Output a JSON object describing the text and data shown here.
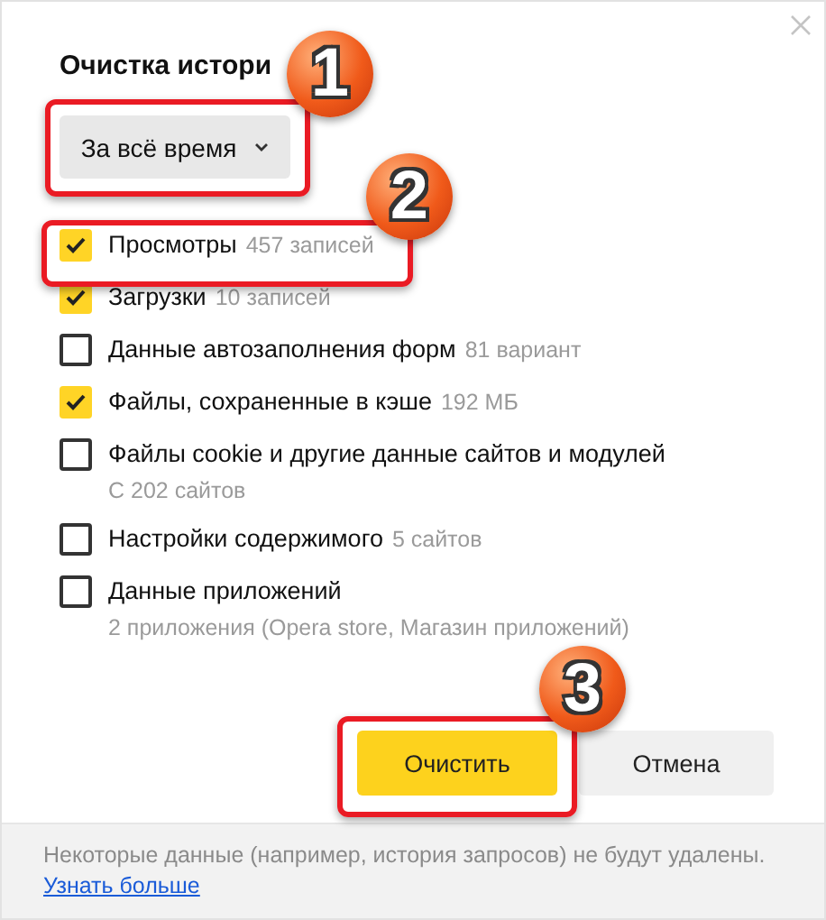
{
  "dialog": {
    "title": "Очистка истори",
    "period": {
      "label": "За всё время"
    }
  },
  "items": [
    {
      "label": "Просмотры",
      "count": "457 записей",
      "checked": true
    },
    {
      "label": "Загрузки",
      "count": "10 записей",
      "checked": true
    },
    {
      "label": "Данные автозаполнения форм",
      "count": "81 вариант",
      "checked": false
    },
    {
      "label": "Файлы, сохраненные в кэше",
      "count": "192 МБ",
      "checked": true
    },
    {
      "label": "Файлы cookie и другие данные сайтов и модулей",
      "subtitle": "С 202 сайтов",
      "checked": false
    },
    {
      "label": "Настройки содержимого",
      "count": "5 сайтов",
      "checked": false
    },
    {
      "label": "Данные приложений",
      "subtitle": "2 приложения (Opera store, Магазин приложений)",
      "checked": false
    }
  ],
  "buttons": [
    {
      "label": "Очистить",
      "kind": "primary"
    },
    {
      "label": "Отмена",
      "kind": "secondary"
    }
  ],
  "footer": {
    "note": "Некоторые данные (например, история запросов) не будут удалены.",
    "link": "Узнать больше"
  },
  "annotations": [
    {
      "number": "1"
    },
    {
      "number": "2"
    },
    {
      "number": "3"
    }
  ]
}
